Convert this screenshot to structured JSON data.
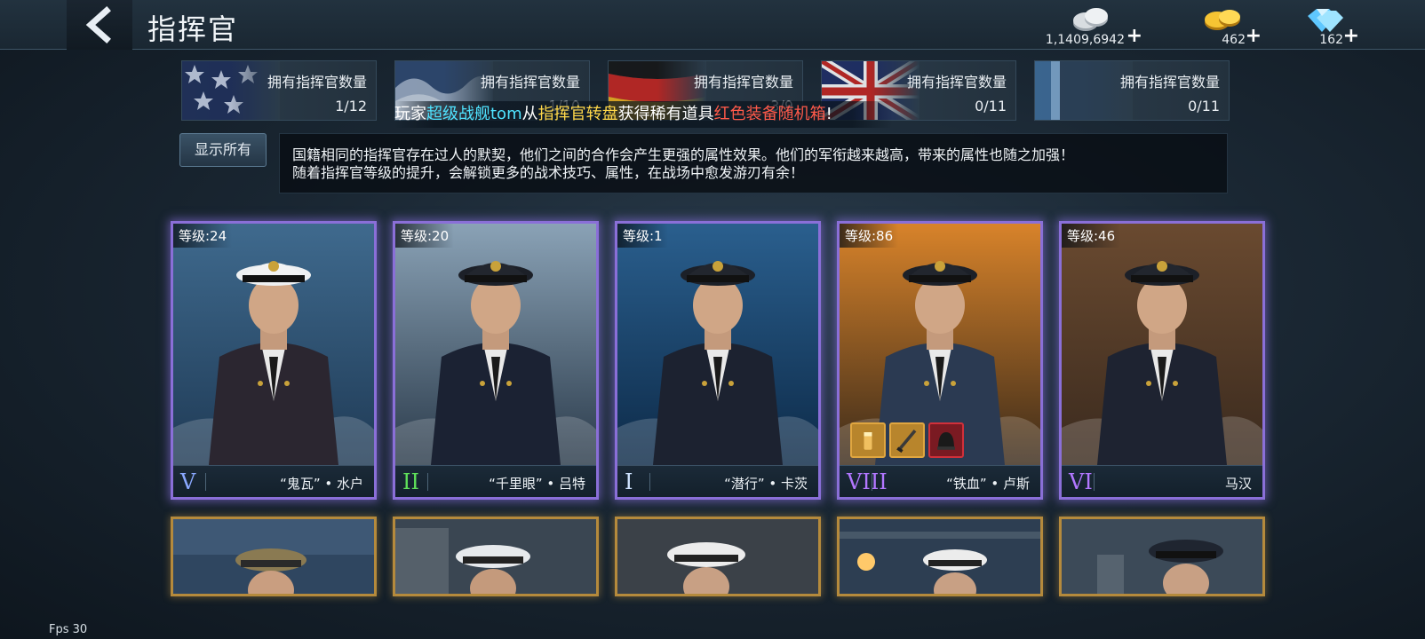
{
  "header": {
    "title": "指挥官",
    "back_icon": "chevron-left-icon"
  },
  "currencies": [
    {
      "name": "silver",
      "icon": "silver-coins-icon",
      "amount": "1,1409,6942",
      "plus": "+"
    },
    {
      "name": "gold",
      "icon": "gold-coins-icon",
      "amount": "462",
      "plus": "+"
    },
    {
      "name": "diamond",
      "icon": "diamond-icon",
      "amount": "162",
      "plus": "+"
    }
  ],
  "nations": [
    {
      "flag": "usa-flag",
      "label": "拥有指挥官数量",
      "count": "1/12"
    },
    {
      "flag": "japan-flag",
      "label": "拥有指挥官数量",
      "count": "1/10"
    },
    {
      "flag": "germany-flag",
      "label": "拥有指挥官数量",
      "count": "3/9"
    },
    {
      "flag": "uk-flag",
      "label": "拥有指挥官数量",
      "count": "0/11"
    },
    {
      "flag": "ussr-flag",
      "label": "拥有指挥官数量",
      "count": "0/11"
    }
  ],
  "marquee": {
    "prefix": "玩家",
    "player": "超级战舰tom",
    "from": "从",
    "source": "指挥官转盘",
    "got": "获得稀有道具",
    "item": "红色装备随机箱",
    "end": "!"
  },
  "show_all_label": "显示所有",
  "description": {
    "line1": "国籍相同的指挥官存在过人的默契，他们之间的合作会产生更强的属性效果。他们的军衔越来越高，带来的属性也随之加强！",
    "line2": "随着指挥官等级的提升，会解锁更多的战术技巧、属性，在战场中愈发游刃有余！"
  },
  "commanders": [
    {
      "level": "等级:24",
      "rank": "V",
      "rank_color": "#8aa8ff",
      "name": "“鬼瓦” • 水户",
      "uniform": "#2b2630"
    },
    {
      "level": "等级:20",
      "rank": "II",
      "rank_color": "#5fe05a",
      "name": "“千里眼” • 吕特",
      "uniform": "#1b2233"
    },
    {
      "level": "等级:1",
      "rank": "I",
      "rank_color": "#cfe3ff",
      "name": "“潜行” • 卡茨",
      "uniform": "#1c2230"
    },
    {
      "level": "等级:86",
      "rank": "VIII",
      "rank_color": "#b277ff",
      "name": "“铁血” • 卢斯",
      "uniform": "#2b3a52"
    },
    {
      "level": "等级:46",
      "rank": "VI",
      "rank_color": "#b277ff",
      "name": "马汉",
      "uniform": "#1e2331"
    }
  ],
  "equipment_icons": [
    "shell-icon",
    "sword-icon",
    "helmet-icon"
  ],
  "fps_label": "Fps 30"
}
